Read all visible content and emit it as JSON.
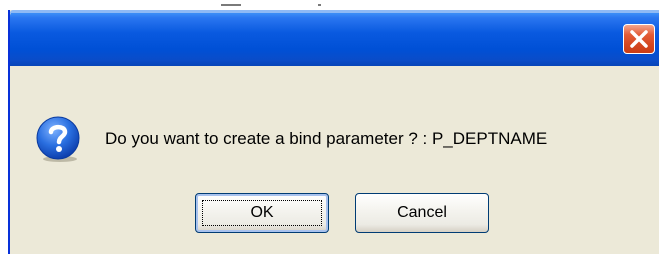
{
  "dialog": {
    "title": "",
    "message": "Do you want to create a bind parameter ? : P_DEPTNAME",
    "ok_label": "OK",
    "cancel_label": "Cancel",
    "icon": "question-icon",
    "close_icon": "close-icon"
  },
  "colors": {
    "titlebar": "#0a5ae0",
    "dialog_bg": "#ece9d8",
    "close_button": "#d44720",
    "button_border": "#003c74",
    "icon_blue": "#1c5fd6"
  }
}
